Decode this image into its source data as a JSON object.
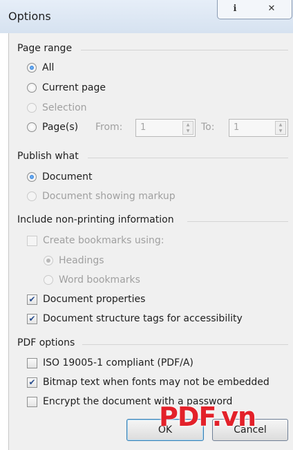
{
  "dialog": {
    "title": "Options",
    "help_glyph": "ℹ",
    "close_glyph": "✕"
  },
  "page_range": {
    "header": "Page range",
    "all_label": "All",
    "current_page_label": "Current page",
    "selection_label": "Selection",
    "pages_label": "Page(s)",
    "from_label": "From:",
    "from_value": "1",
    "to_label": "To:",
    "to_value": "1"
  },
  "publish_what": {
    "header": "Publish what",
    "document_label": "Document",
    "document_markup_label": "Document showing markup"
  },
  "non_printing": {
    "header": "Include non-printing information",
    "create_bookmarks_label": "Create bookmarks using:",
    "headings_label": "Headings",
    "word_bookmarks_label": "Word bookmarks",
    "doc_properties_label": "Document properties",
    "structure_tags_label": "Document structure tags for accessibility"
  },
  "pdf_options": {
    "header": "PDF options",
    "iso_label": "ISO 19005-1 compliant (PDF/A)",
    "bitmap_label": "Bitmap text when fonts may not be embedded",
    "encrypt_label": "Encrypt the document with a password"
  },
  "buttons": {
    "ok_label": "OK",
    "cancel_label": "Cancel"
  },
  "watermark": {
    "text": "PDF.vn"
  },
  "colors": {
    "accent": "#1a64c8",
    "watermark": "#e3212a"
  }
}
